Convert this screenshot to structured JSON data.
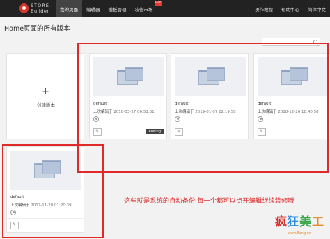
{
  "header": {
    "logo_line1": "STORE",
    "logo_line2": "Builder",
    "nav": [
      {
        "label": "我的页面",
        "active": true
      },
      {
        "label": "编辑器",
        "active": false
      },
      {
        "label": "模板管理",
        "active": false
      },
      {
        "label": "装修市场",
        "active": false,
        "badge": "Hot"
      }
    ],
    "right_links": [
      "操作教程",
      "帮助中心",
      "简体中文"
    ]
  },
  "page": {
    "title": "Home页面的所有版本"
  },
  "create_card": {
    "plus": "+",
    "label": "创建版本"
  },
  "editor_label": "上次编辑于",
  "versions": [
    {
      "name": "default",
      "edited": "2018-03-27 06:51:31",
      "tag": "editing"
    },
    {
      "name": "default",
      "edited": "2019-01-07 22:19:58",
      "tag": ""
    },
    {
      "name": "default",
      "edited": "2018-12-26 18:40:58",
      "tag": ""
    },
    {
      "name": "default",
      "edited": "2017-11-28 01:20:39",
      "tag": ""
    }
  ],
  "annotation": "这些就是系统的自动备份  每一个都可以点开编辑继续装修哦",
  "watermark": {
    "chars": [
      "疯",
      "狂",
      "美",
      "工"
    ],
    "sub": "www.fkmg.cn"
  },
  "colors": {
    "topbar": "#222222",
    "highlight": "#e02a2a",
    "badge": "#e23d2e"
  }
}
